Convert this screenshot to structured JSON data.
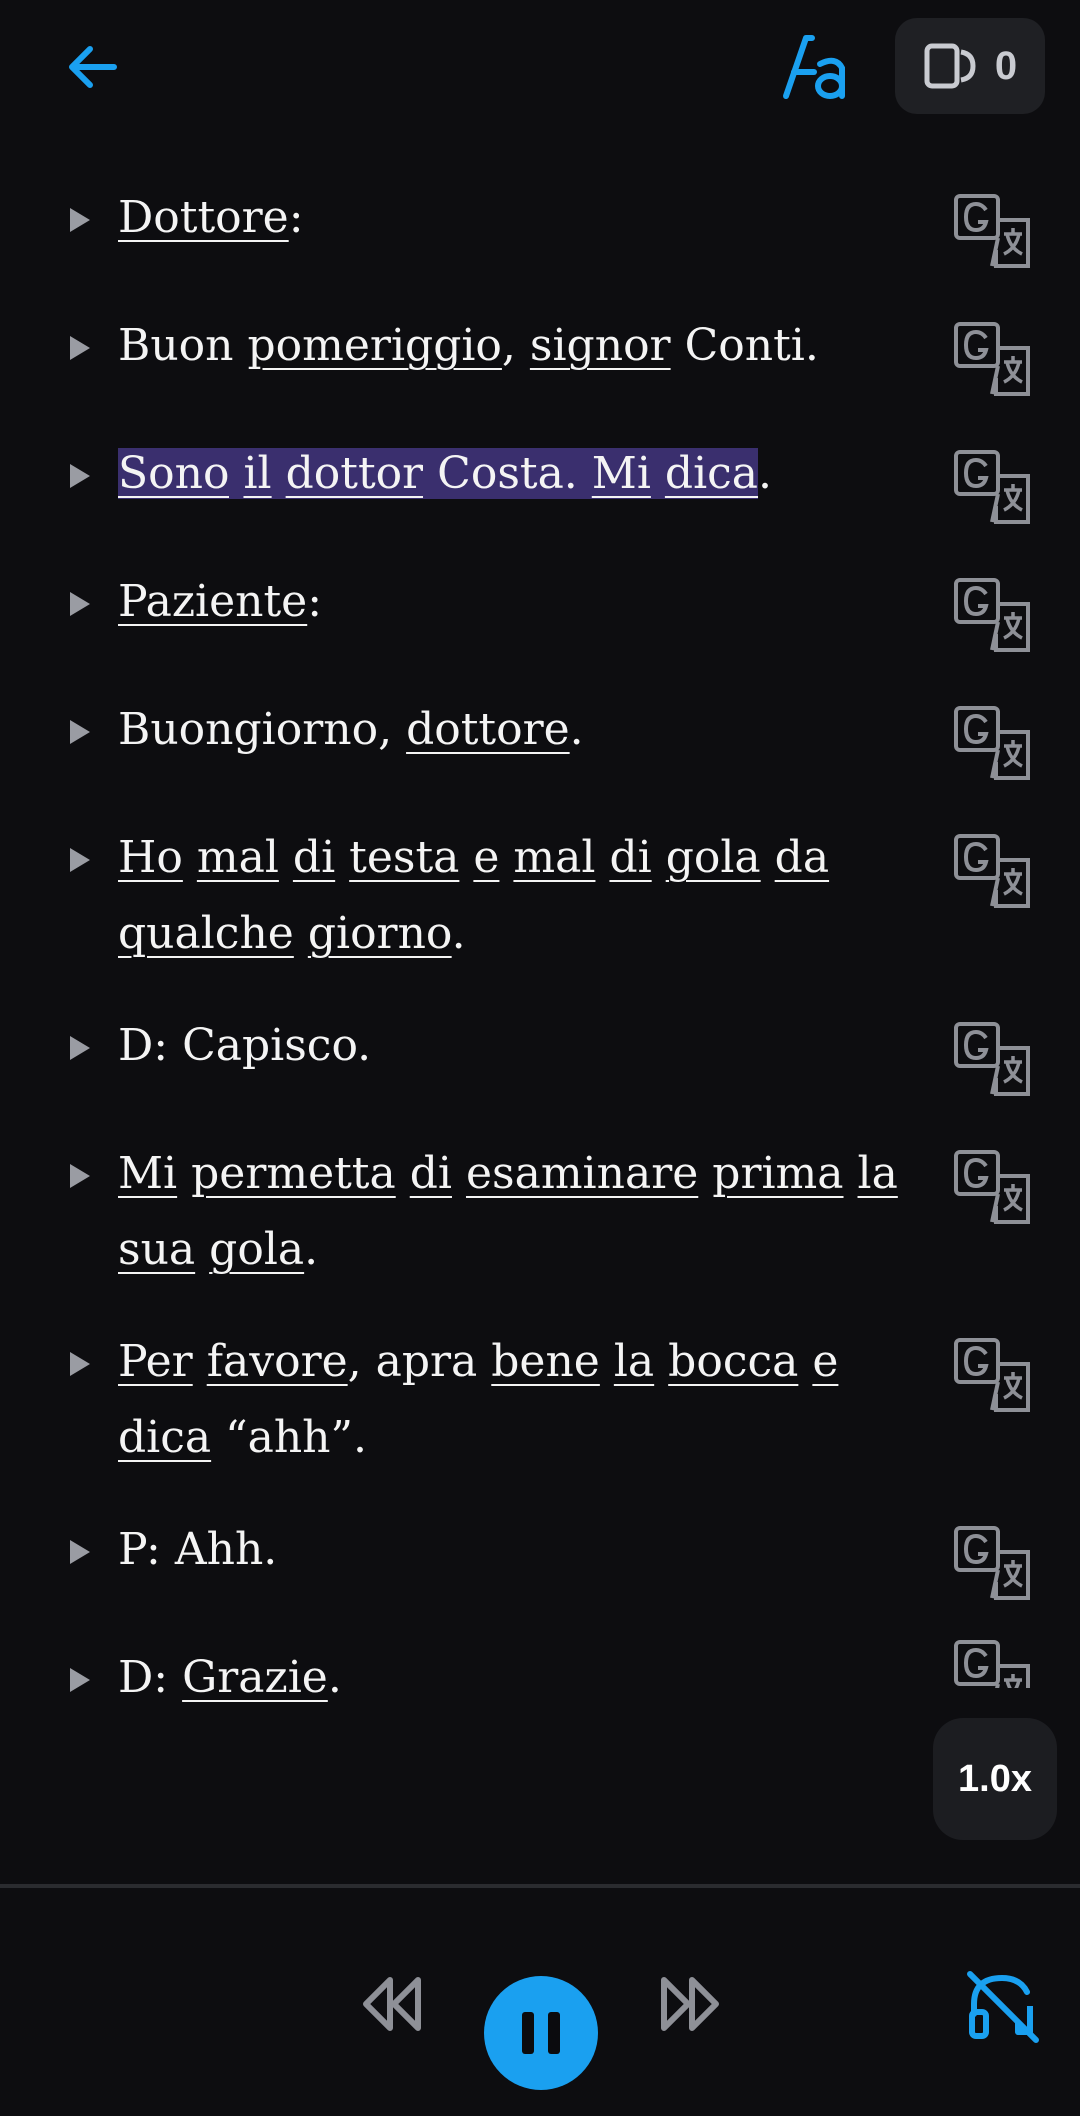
{
  "theme": {
    "background": "#0d0d10",
    "accent": "#1aa0f0",
    "highlight": "#3a2f6e"
  },
  "header": {
    "cards_count": "0"
  },
  "lines": [
    {
      "segments": [
        {
          "t": "Dottore",
          "u": true
        },
        {
          "t": ":"
        }
      ]
    },
    {
      "segments": [
        {
          "t": "Buon "
        },
        {
          "t": "pomeriggio",
          "u": true
        },
        {
          "t": ", "
        },
        {
          "t": "signor",
          "u": true
        },
        {
          "t": " Conti."
        }
      ]
    },
    {
      "segments": [
        {
          "t": "Sono",
          "u": true,
          "h": true
        },
        {
          "t": " ",
          "h": true
        },
        {
          "t": "il",
          "u": true,
          "h": true
        },
        {
          "t": " ",
          "h": true
        },
        {
          "t": "dottor",
          "u": true,
          "h": true
        },
        {
          "t": " Costa. ",
          "h": true
        },
        {
          "t": "Mi",
          "u": true,
          "h": true
        },
        {
          "t": " ",
          "h": true
        },
        {
          "t": "dica",
          "u": true,
          "h": true
        },
        {
          "t": "."
        }
      ]
    },
    {
      "segments": [
        {
          "t": "Paziente",
          "u": true
        },
        {
          "t": ":"
        }
      ]
    },
    {
      "segments": [
        {
          "t": "Buongiorno, "
        },
        {
          "t": "dottore",
          "u": true
        },
        {
          "t": "."
        }
      ]
    },
    {
      "segments": [
        {
          "t": "Ho",
          "u": true
        },
        {
          "t": " "
        },
        {
          "t": "mal",
          "u": true
        },
        {
          "t": " "
        },
        {
          "t": "di",
          "u": true
        },
        {
          "t": " "
        },
        {
          "t": "testa",
          "u": true
        },
        {
          "t": " "
        },
        {
          "t": "e",
          "u": true
        },
        {
          "t": " "
        },
        {
          "t": "mal",
          "u": true
        },
        {
          "t": " "
        },
        {
          "t": "di",
          "u": true
        },
        {
          "t": " "
        },
        {
          "t": "gola",
          "u": true
        },
        {
          "t": " "
        },
        {
          "t": "da",
          "u": true
        },
        {
          "t": " "
        },
        {
          "t": "qualche",
          "u": true
        },
        {
          "t": " "
        },
        {
          "t": "giorno",
          "u": true
        },
        {
          "t": "."
        }
      ]
    },
    {
      "segments": [
        {
          "t": "D: Capisco."
        }
      ]
    },
    {
      "segments": [
        {
          "t": "Mi",
          "u": true
        },
        {
          "t": " "
        },
        {
          "t": "permetta",
          "u": true
        },
        {
          "t": " "
        },
        {
          "t": "di",
          "u": true
        },
        {
          "t": " "
        },
        {
          "t": "esaminare",
          "u": true
        },
        {
          "t": " "
        },
        {
          "t": "prima",
          "u": true
        },
        {
          "t": " "
        },
        {
          "t": "la",
          "u": true
        },
        {
          "t": " "
        },
        {
          "t": "sua",
          "u": true
        },
        {
          "t": " "
        },
        {
          "t": "gola",
          "u": true
        },
        {
          "t": "."
        }
      ]
    },
    {
      "segments": [
        {
          "t": "Per",
          "u": true
        },
        {
          "t": " "
        },
        {
          "t": "favore",
          "u": true
        },
        {
          "t": ", apra "
        },
        {
          "t": "bene",
          "u": true
        },
        {
          "t": " "
        },
        {
          "t": "la",
          "u": true
        },
        {
          "t": " "
        },
        {
          "t": "bocca",
          "u": true
        },
        {
          "t": " "
        },
        {
          "t": "e",
          "u": true
        },
        {
          "t": " "
        },
        {
          "t": "dica",
          "u": true
        },
        {
          "t": " “ahh”."
        }
      ]
    },
    {
      "segments": [
        {
          "t": "P: Ahh."
        }
      ]
    },
    {
      "segments": [
        {
          "t": "D: "
        },
        {
          "t": "Grazie",
          "u": true
        },
        {
          "t": "."
        }
      ]
    }
  ],
  "playback": {
    "speed_label": "1.0x"
  },
  "icons": {
    "back": "arrow-left-icon",
    "font": "font-size-icon",
    "cards": "flashcards-icon",
    "line_play": "play-line-icon",
    "translate": "translate-icon",
    "rewind": "rewind-icon",
    "pause": "pause-icon",
    "forward": "fast-forward-icon",
    "audio_off": "headphones-off-icon"
  }
}
